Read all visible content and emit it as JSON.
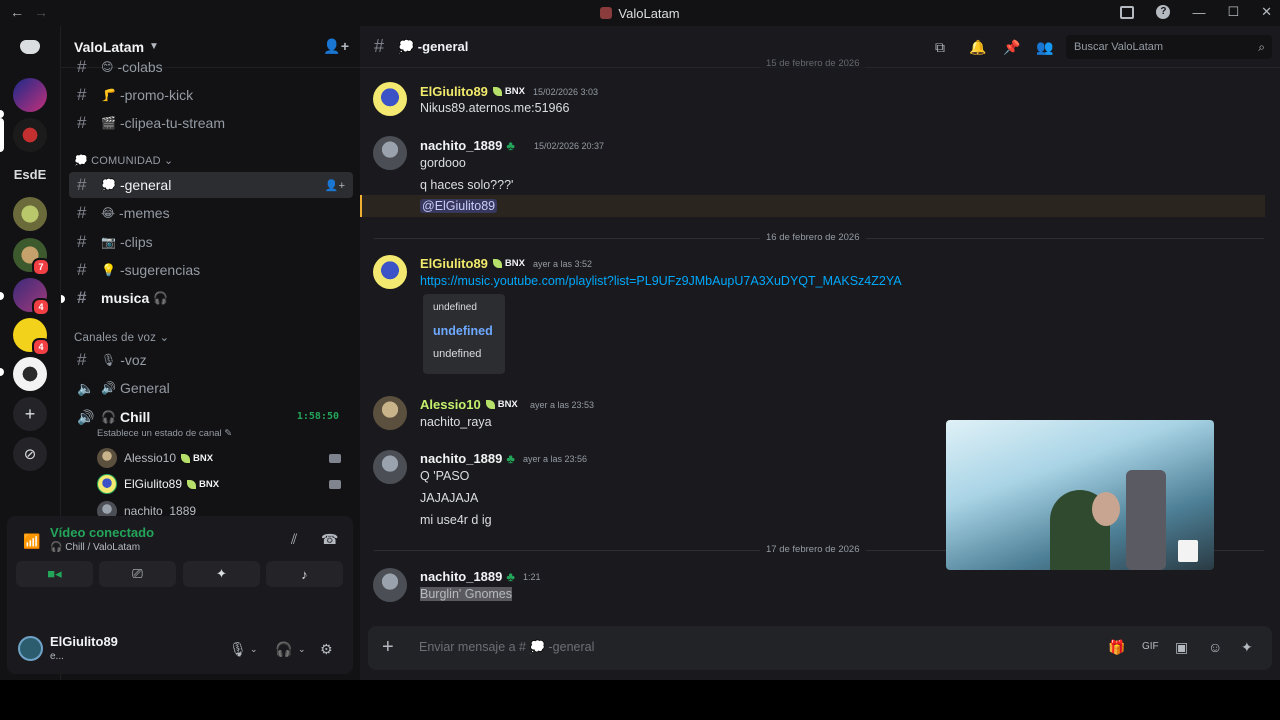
{
  "window": {
    "title": "ValoLatam",
    "back": "←",
    "forward": "→"
  },
  "window_controls": {
    "minimize": "—",
    "maximize": "☐",
    "close": "✕"
  },
  "rail": {
    "text_server": "EsdE",
    "badges": [
      "7",
      "4",
      "4"
    ],
    "add_label": "+",
    "explore_label": "⊘"
  },
  "guild": {
    "name": "ValoLatam",
    "invite_icon": "add-member-icon"
  },
  "channels": {
    "top": [
      {
        "emoji": "😊",
        "name": "-colabs"
      },
      {
        "emoji": "🦵",
        "name": "-promo-kick"
      },
      {
        "emoji": "🎬",
        "name": "-clipea-tu-stream"
      }
    ],
    "category_comunidad": "COMUNIDAD",
    "comunidad": [
      {
        "emoji": "💭",
        "name": "-general"
      },
      {
        "emoji": "😂",
        "name": "-memes"
      },
      {
        "emoji": "📷",
        "name": "-clips"
      },
      {
        "emoji": "💡",
        "name": "-sugerencias"
      },
      {
        "emoji": "🎧",
        "name": "musica"
      }
    ],
    "category_voz": "Canales de voz",
    "voz": [
      {
        "emoji": "🎙",
        "name": "-voz"
      },
      {
        "emoji": "🔊",
        "name": "General"
      },
      {
        "emoji": "🎧",
        "name": "Chill"
      }
    ],
    "voice_timer": "1:58:50",
    "voice_status_hint": "Establece un estado de canal",
    "voice_users": [
      {
        "name": "Alessio10",
        "tag": "BNX"
      },
      {
        "name": "ElGiulito89",
        "tag": "BNX"
      },
      {
        "name": "nachito_1889",
        "tag": ""
      }
    ]
  },
  "voice_panel": {
    "status": "Vídeo conectado",
    "location": "🎧 Chill / ValoLatam"
  },
  "user_panel": {
    "name": "ElGiulito89",
    "status": "e..."
  },
  "chat": {
    "channel_name": "💭 -general",
    "search_placeholder": "Buscar ValoLatam",
    "top_partial_date": "15 de febrero de 2026",
    "messages": [
      {
        "author": "ElGiulito89",
        "tag": "BNX",
        "time": "15/02/2026 3:03",
        "lines": [
          "Nikus89.aternos.me:51966"
        ]
      },
      {
        "author": "nachito_1889",
        "tag": "",
        "time": "15/02/2026 20:37",
        "lines": [
          "gordooo",
          "q haces solo???'"
        ],
        "mention": "@ElGiulito89"
      },
      {
        "author": "ElGiulito89",
        "tag": "BNX",
        "time": "ayer a las 3:52",
        "link": "https://music.youtube.com/playlist?list=PL9UFz9JMbAupU7A3XuDYQT_MAKSz4Z2YA"
      },
      {
        "author": "Alessio10",
        "tag": "BNX",
        "time": "ayer a las 23:53",
        "lines": [
          "nachito_raya"
        ]
      },
      {
        "author": "nachito_1889",
        "tag": "",
        "time": "ayer a las 23:56",
        "lines": [
          "Q 'PASO",
          "JAJAJAJA",
          "mi use4r d ig"
        ]
      },
      {
        "author": "nachito_1889",
        "tag": "",
        "time": "1:21",
        "lines": [
          "Burglin' Gnomes"
        ]
      }
    ],
    "date_dividers": [
      "16 de febrero de 2026",
      "17 de febrero de 2026"
    ],
    "embed": {
      "line1": "undefined",
      "line2": "undefined",
      "line3": "undefined"
    },
    "composer_placeholder": "Enviar mensaje a # 💭 -general"
  },
  "colors": {
    "accent_green": "#23a55a",
    "name_yellow": "#f0e96c",
    "link_blue": "#00a8fc"
  }
}
